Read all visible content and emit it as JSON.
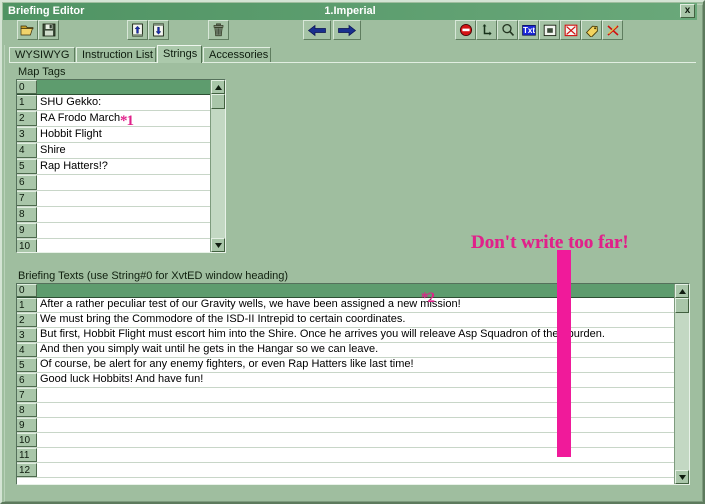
{
  "window": {
    "title": "Briefing Editor",
    "center_title": "1.Imperial",
    "close_label": "x"
  },
  "toolbar": {
    "buttons": [
      {
        "name": "open-file-button",
        "icon": "folder-open-icon",
        "title": "Open"
      },
      {
        "name": "save-file-button",
        "icon": "floppy-disk-icon",
        "title": "Save"
      },
      {
        "name": "insert-before-button",
        "icon": "insert-up-icon",
        "title": "Insert"
      },
      {
        "name": "insert-after-button",
        "icon": "insert-down-icon",
        "title": "Insert After"
      },
      {
        "name": "delete-button",
        "icon": "trash-can-icon",
        "title": "Delete"
      },
      {
        "name": "previous-button",
        "icon": "arrow-left-icon",
        "title": "Previous"
      },
      {
        "name": "next-button",
        "icon": "arrow-right-icon",
        "title": "Next"
      },
      {
        "name": "stop-button",
        "icon": "stop-sign-icon",
        "title": "Stop"
      },
      {
        "name": "move-button",
        "icon": "move-arrow-icon",
        "title": "Move"
      },
      {
        "name": "zoom-button",
        "icon": "magnifier-icon",
        "title": "Zoom"
      },
      {
        "name": "text-button",
        "icon": "text-box-icon",
        "title": "Text"
      },
      {
        "name": "page-button",
        "icon": "page-icon",
        "title": "Page"
      },
      {
        "name": "delete-x-button",
        "icon": "red-x-box-icon",
        "title": "Delete"
      },
      {
        "name": "tag-button",
        "icon": "yellow-tag-icon",
        "title": "Tag"
      },
      {
        "name": "clear-all-button",
        "icon": "red-cross-tools-icon",
        "title": "Clear"
      }
    ]
  },
  "tabs": [
    {
      "label": "WYSIWYG",
      "active": false
    },
    {
      "label": "Instruction List",
      "active": false
    },
    {
      "label": "Strings",
      "active": true
    },
    {
      "label": "Accessories",
      "active": false
    }
  ],
  "map_tags": {
    "label": "Map Tags",
    "rows": [
      {
        "num": "0",
        "text": ""
      },
      {
        "num": "1",
        "text": "SHU Gekko:"
      },
      {
        "num": "2",
        "text": "RA Frodo March"
      },
      {
        "num": "3",
        "text": "Hobbit Flight"
      },
      {
        "num": "4",
        "text": "Shire"
      },
      {
        "num": "5",
        "text": "Rap Hatters!?"
      },
      {
        "num": "6",
        "text": ""
      },
      {
        "num": "7",
        "text": ""
      },
      {
        "num": "8",
        "text": ""
      },
      {
        "num": "9",
        "text": ""
      },
      {
        "num": "10",
        "text": ""
      }
    ]
  },
  "briefing_texts": {
    "label": "Briefing Texts   (use String#0 for XvtED window heading)",
    "rows": [
      {
        "num": "0",
        "text": ""
      },
      {
        "num": "1",
        "text": "After a rather peculiar test of our Gravity wells, we have been assigned a new mission!"
      },
      {
        "num": "2",
        "text": "We must bring the Commodore of the ISD-II Intrepid to certain coordinates."
      },
      {
        "num": "3",
        "text": "But first, Hobbit Flight must escort him into the Shire.  Once he arrives you will releave Asp Squadron of their burden."
      },
      {
        "num": "4",
        "text": "And then you simply wait until he gets in the Hangar so we can leave."
      },
      {
        "num": "5",
        "text": "Of course, be alert for any enemy fighters, or even Rap Hatters like last time!"
      },
      {
        "num": "6",
        "text": "Good luck Hobbits! And have fun!"
      },
      {
        "num": "7",
        "text": ""
      },
      {
        "num": "8",
        "text": ""
      },
      {
        "num": "9",
        "text": ""
      },
      {
        "num": "10",
        "text": ""
      },
      {
        "num": "11",
        "text": ""
      },
      {
        "num": "12",
        "text": ""
      }
    ]
  },
  "annotations": {
    "star1": "*1",
    "star2": "*2",
    "headline": "Don't write too far!",
    "marker_color": "#f01a9a",
    "text_color": "#e0218a"
  }
}
